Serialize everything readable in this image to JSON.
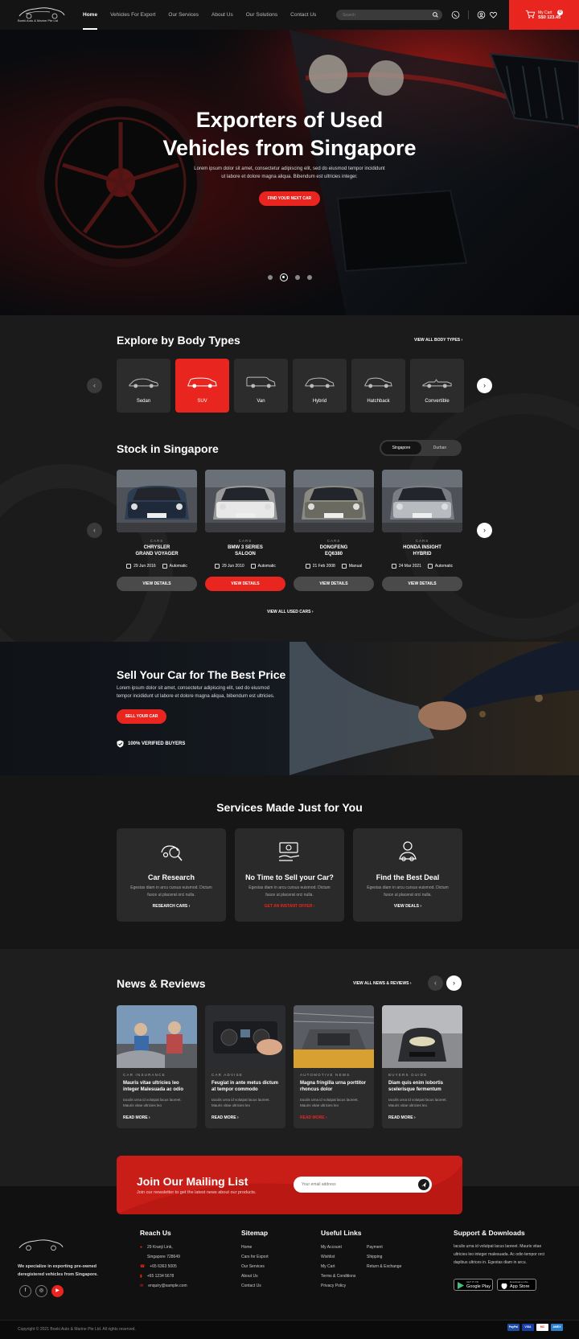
{
  "header": {
    "logo_text": "Boeki Auto & Marine Pte Ltd",
    "nav": [
      "Home",
      "Vehicles For Export",
      "Our Services",
      "About Us",
      "Our Solutions",
      "Contact Us"
    ],
    "search_placeholder": "Search",
    "cart_label": "My Cart",
    "cart_count": "0",
    "cart_amount": "S$0 123.45"
  },
  "hero": {
    "title_line1": "Exporters of Used",
    "title_line2": "Vehicles from Singapore",
    "desc": "Lorem ipsum dolor sit amet, consectetur adipiscing elit, sed do eiusmod tempor incididunt ut labore et dolore magna aliqua. Bibendum est ultricies integer.",
    "button": "FIND YOUR NEXT CAR",
    "slides": 4,
    "active_slide": 2
  },
  "body_types": {
    "title": "Explore by Body Types",
    "view_all": "VIEW ALL BODY TYPES",
    "items": [
      "Sedan",
      "SUV",
      "Van",
      "Hybrid",
      "Hatchback",
      "Convertible"
    ],
    "active": "SUV"
  },
  "stock": {
    "title": "Stock in Singapore",
    "toggle": [
      "Singapore",
      "Durban"
    ],
    "active_toggle": "Singapore",
    "view_all": "VIEW ALL USED CARS",
    "cars": [
      {
        "category": "CARS",
        "name1": "CHRYSLER",
        "name2": "GRAND VOYAGER",
        "date": "29 Jun 2016",
        "trans": "Automatic",
        "button": "VIEW DETAILS"
      },
      {
        "category": "CARS",
        "name1": "BMW 3 SERIES",
        "name2": "SALOON",
        "date": "29 Jun 2010",
        "trans": "Automatic",
        "button": "VIEW DETAILS"
      },
      {
        "category": "CARS",
        "name1": "DONGFENG",
        "name2": "EQ6380",
        "date": "21 Feb 2008",
        "trans": "Manual",
        "button": "VIEW DETAILS"
      },
      {
        "category": "CARS",
        "name1": "HONDA INSIGHT",
        "name2": "HYBRID",
        "date": "24 Mar 2021",
        "trans": "Automatic",
        "button": "VIEW DETAILS"
      }
    ]
  },
  "sell": {
    "title": "Sell Your Car for The Best Price",
    "desc": "Lorem ipsum dolor sit amet, consectetur adipiscing elit, sed do eiusmod tempor incididunt ut labore et dolore magna aliqua, bibendum est ultricies.",
    "button": "SELL YOUR CAR",
    "verified": "100% VERIFIED BUYERS"
  },
  "services": {
    "title": "Services Made Just for You",
    "items": [
      {
        "name": "Car Research",
        "desc": "Egestas diam in arcu cursus euismod. Dictum fusce ut placerat orci nulla.",
        "link": "RESEARCH CARS"
      },
      {
        "name": "No Time to Sell your Car?",
        "desc": "Egestas diam in arcu cursus euismod. Dictum fusce ut placerat orci nulla.",
        "link": "GET AN INSTANT OFFER"
      },
      {
        "name": "Find the Best Deal",
        "desc": "Egestas diam in arcu cursus euismod. Dictum fusce ut placerat orci nulla.",
        "link": "VIEW DEALS"
      }
    ]
  },
  "news": {
    "title": "News & Reviews",
    "view_all": "VIEW ALL NEWS & REVIEWS",
    "items": [
      {
        "category": "CAR INSURANCE",
        "title": "Mauris vitae ultricies leo integer Malesuada ac odio",
        "desc": "Iaculis urna id volutpat lacus laoreet. Mauris vitae ultricies leo",
        "more": "READ MORE"
      },
      {
        "category": "CAR ADVISE",
        "title": "Feugiat in ante metus dictum at tempor commodo",
        "desc": "Iaculis urna id volutpat lacus laoreet. Mauris vitae ultricies leo",
        "more": "READ MORE"
      },
      {
        "category": "AUTOMOTIVE NEWS",
        "title": "Magna fringilla urna porttitor rhoncus dolor",
        "desc": "Iaculis urna id volutpat lacus laoreet. Mauris vitae ultricies leo",
        "more": "READ MORE"
      },
      {
        "category": "BUYERS GUIDE",
        "title": "Diam quis enim lobortis scelerisque fermentum",
        "desc": "Iaculis urna id volutpat lacus laoreet. Mauris vitae ultricies leo",
        "more": "READ MORE"
      }
    ]
  },
  "mailing": {
    "title": "Join Our Mailing List",
    "desc": "Join our newsletter to get the latest news about our products.",
    "placeholder": "Your email address"
  },
  "footer": {
    "about": "We specialize in exporting pre-owned deregistered vehicles from Singapore.",
    "reach_title": "Reach Us",
    "address1": "29 Kranji Link,",
    "address2": "Singapore 728649",
    "phone1": "+65 6363 5005",
    "phone2": "+65 1234 5678",
    "email": "enquiry@sample.com",
    "sitemap_title": "Sitemap",
    "sitemap": [
      "Home",
      "Cars for Export",
      "Our Services",
      "About Us",
      "Contact Us"
    ],
    "useful_title": "Useful Links",
    "useful_col1": [
      "My Account",
      "Wishlist",
      "My Cart",
      "Terms & Conditions",
      "Privacy Policy"
    ],
    "useful_col2": [
      "Payment",
      "Shipping",
      "Return & Exchange"
    ],
    "support_title": "Support & Downloads",
    "support_desc": "Iaculis urna id volutpat lacus laoreet. Mauris vitae ultricies leo integer malesuada. Ac odio tempor orci dapibus ultrices in. Egestas diam in arcu.",
    "google_sub": "GET IT ON",
    "google": "Google Play",
    "apple_sub": "Download on the",
    "apple": "App Store",
    "copyright": "Copyright © 2021 Boeki Auto & Marine Pte Ltd. All rights reserved.",
    "payments": [
      "PayPal",
      "VISA",
      "MC",
      "AMEX"
    ]
  },
  "colors": {
    "accent": "#e8251f",
    "bg": "#1c1c1c"
  }
}
